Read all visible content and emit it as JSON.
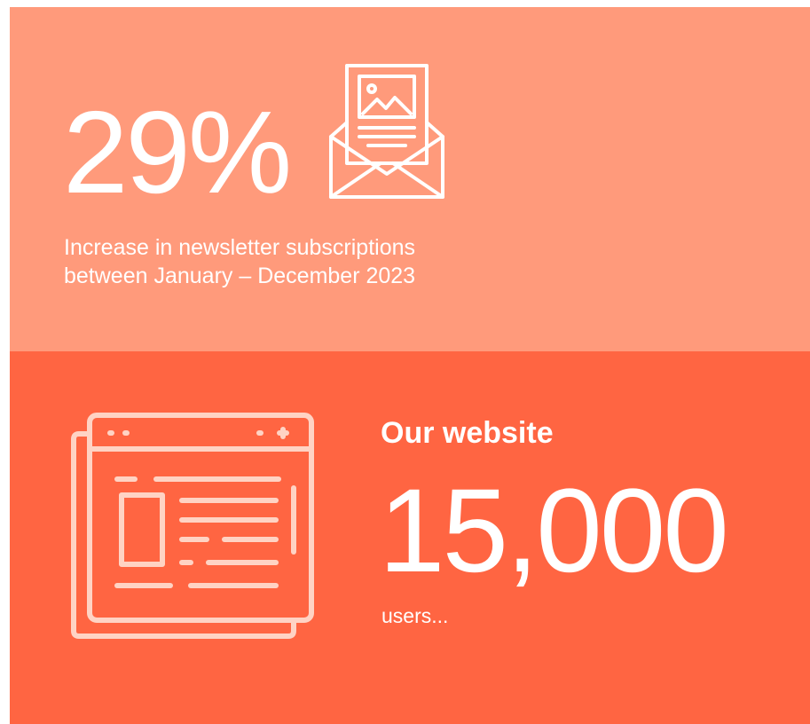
{
  "colors": {
    "top_panel_bg": "#FF9A7B",
    "bottom_panel_bg": "#FF6542",
    "text": "#FFFFFF",
    "icon_stroke_top": "#FFFFFF",
    "icon_stroke_bottom": "#FFD3C4"
  },
  "newsletter": {
    "stat": "29%",
    "icon": "newsletter-envelope-icon",
    "caption_line1": "Increase in newsletter subscriptions",
    "caption_line2": "between January – December 2023"
  },
  "website": {
    "heading": "Our website",
    "stat": "15,000",
    "unit": "users...",
    "icon": "browser-window-icon"
  }
}
